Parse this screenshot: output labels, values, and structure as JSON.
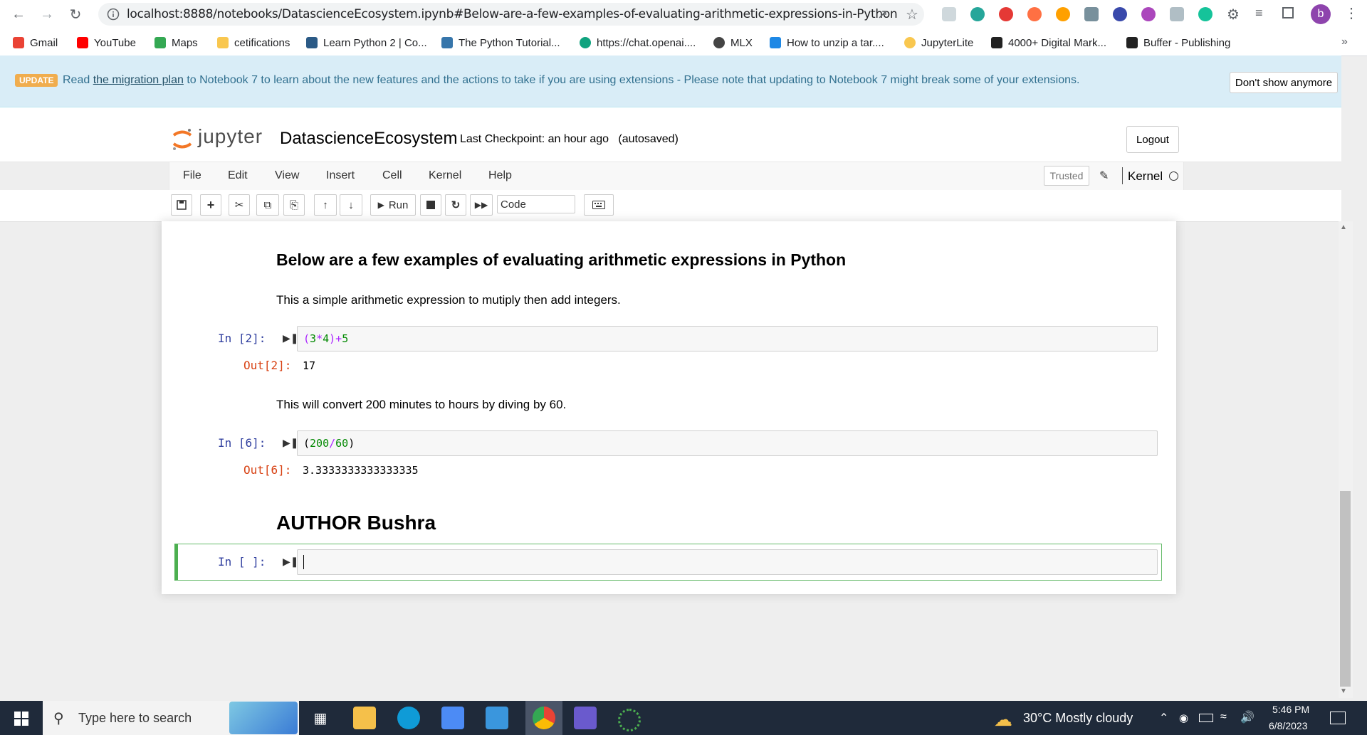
{
  "browser": {
    "url": "localhost:8888/notebooks/DatascienceEcosystem.ipynb#Below-are-a-few-examples-of-evaluating-arithmetic-expressions-in-Python",
    "profile_initial": "b",
    "bookmarks": [
      {
        "label": "Gmail",
        "color": "#ea4335"
      },
      {
        "label": "YouTube",
        "color": "#ff0000"
      },
      {
        "label": "Maps",
        "color": "#34a853"
      },
      {
        "label": "cetifications",
        "color": "#f9c74f"
      },
      {
        "label": "Learn Python 2 | Co...",
        "color": "#2b5a86"
      },
      {
        "label": "The Python Tutorial...",
        "color": "#3776ab"
      },
      {
        "label": "https://chat.openai....",
        "color": "#10a37f"
      },
      {
        "label": "MLX",
        "color": "#444444"
      },
      {
        "label": "How to unzip a tar....",
        "color": "#1e88e5"
      },
      {
        "label": "JupyterLite",
        "color": "#f9c74f"
      },
      {
        "label": "4000+ Digital Mark...",
        "color": "#222222"
      },
      {
        "label": "Buffer - Publishing",
        "color": "#222222"
      }
    ],
    "more_bookmarks": "»"
  },
  "banner": {
    "badge": "UPDATE",
    "prefix": "Read ",
    "link": "the migration plan",
    "suffix": " to Notebook 7 to learn about the new features and the actions to take if you are using extensions - Please note that updating to Notebook 7 might break some of your extensions.",
    "dismiss": "Don't show anymore"
  },
  "header": {
    "logo_text": "jupyter",
    "notebook_name": "DatascienceEcosystem",
    "checkpoint": "Last Checkpoint: an hour ago",
    "autosave": "(autosaved)",
    "logout": "Logout"
  },
  "menubar": {
    "items": [
      "File",
      "Edit",
      "View",
      "Insert",
      "Cell",
      "Kernel",
      "Help"
    ],
    "trusted": "Trusted",
    "kernel": "Kernel"
  },
  "toolbar": {
    "run_label": "Run",
    "cell_type": "Code"
  },
  "cells": {
    "heading": "Below are a few examples of evaluating arithmetic expressions in Python",
    "para1": "This a simple arithmetic expression to mutiply then add integers.",
    "cell1": {
      "in": "In [2]:",
      "out": "Out[2]:",
      "output": "17"
    },
    "para2": "This will convert 200 minutes to hours by diving by 60.",
    "cell2": {
      "in": "In [6]:",
      "out": "Out[6]:",
      "output": "3.3333333333333335"
    },
    "author": "AUTHOR Bushra",
    "cell3": {
      "in": "In [ ]:"
    }
  },
  "taskbar": {
    "search_placeholder": "Type here to search",
    "weather": "30°C  Mostly cloudy",
    "time": "5:46 PM",
    "date": "6/8/2023"
  }
}
